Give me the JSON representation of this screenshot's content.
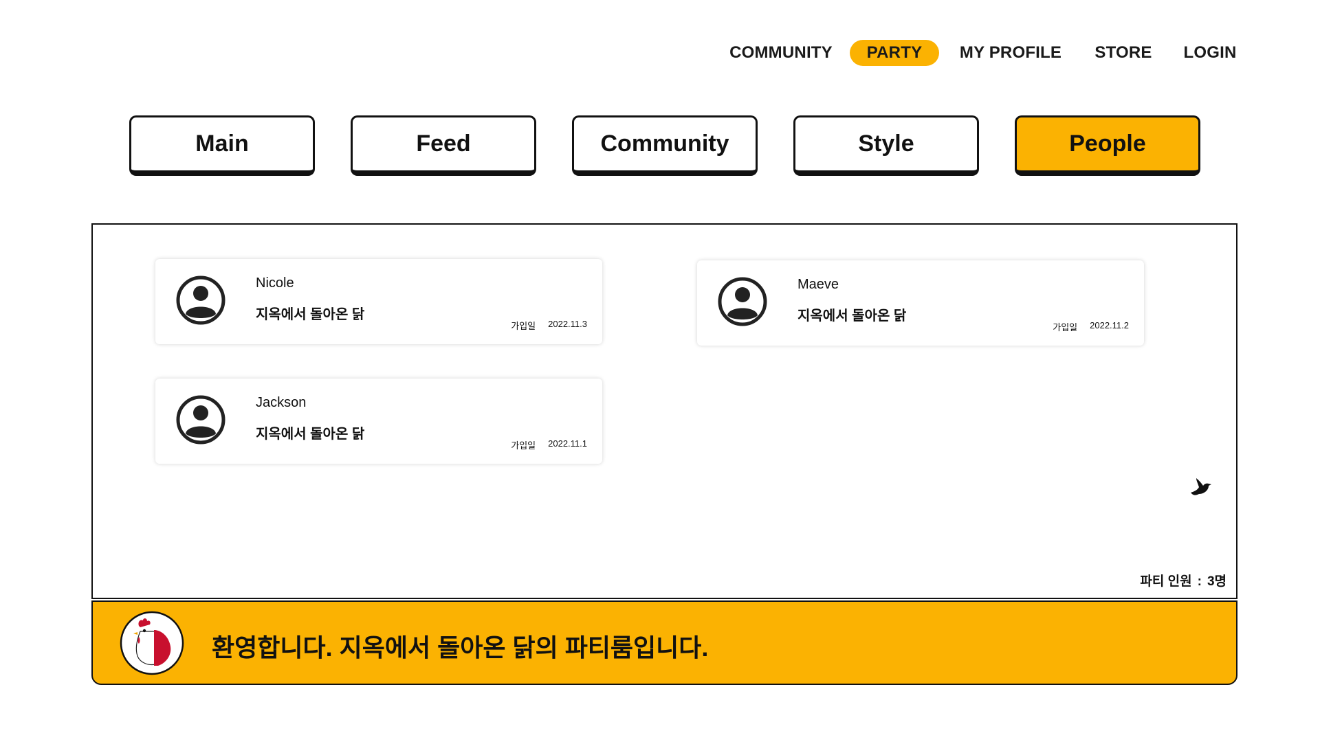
{
  "nav": {
    "community": "COMMUNITY",
    "party": "PARTY",
    "my_profile": "MY PROFILE",
    "store": "STORE",
    "login": "LOGIN"
  },
  "categories": [
    {
      "label": "Main",
      "active": false
    },
    {
      "label": "Feed",
      "active": false
    },
    {
      "label": "Community",
      "active": false
    },
    {
      "label": "Style",
      "active": false
    },
    {
      "label": "People",
      "active": true
    }
  ],
  "members": [
    {
      "name": "Nicole",
      "status": "지옥에서 돌아온 닭",
      "join_label": "가입일",
      "join_date": "2022.11.3"
    },
    {
      "name": "Maeve",
      "status": "지옥에서 돌아온 닭",
      "join_label": "가입일",
      "join_date": "2022.11.2"
    },
    {
      "name": "Jackson",
      "status": "지옥에서 돌아온 닭",
      "join_label": "가입일",
      "join_date": "2022.11.1"
    }
  ],
  "party": {
    "count_label": "파티 인원",
    "separator": ":",
    "count_value": "3명"
  },
  "banner": {
    "welcome": "환영합니다. 지옥에서 돌아온 닭의 파티룸입니다."
  },
  "colors": {
    "accent": "#fbb202",
    "text": "#111111",
    "background": "#ffffff"
  },
  "icons": {
    "avatar": "user-circle-icon",
    "bird": "bird-icon",
    "logo": "chicken-logo"
  }
}
